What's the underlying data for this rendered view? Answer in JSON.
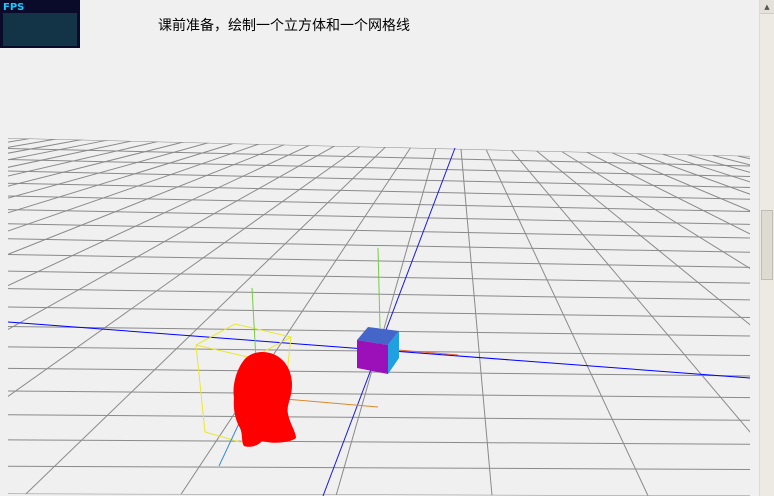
{
  "fps": {
    "label": "FPS"
  },
  "page": {
    "title": "课前准备，绘制一个立方体和一个网格线"
  },
  "scrollbar": {
    "up_arrow": "▲"
  },
  "colors": {
    "background": "#f0f0f0",
    "grid": "#8a8a8a",
    "axis_x": "#0000ff",
    "axis_z": "#2a2ad8",
    "cube_top": "#4466c8",
    "cube_front": "#9b10b8",
    "cube_side": "#1fa0e0",
    "head": "#ff0000",
    "bbox": "#e8e830",
    "axis_green": "#66cc33",
    "axis_orange": "#d88a30",
    "fps_panel": "#0a0a2a",
    "fps_text": "#1ec8ff"
  }
}
